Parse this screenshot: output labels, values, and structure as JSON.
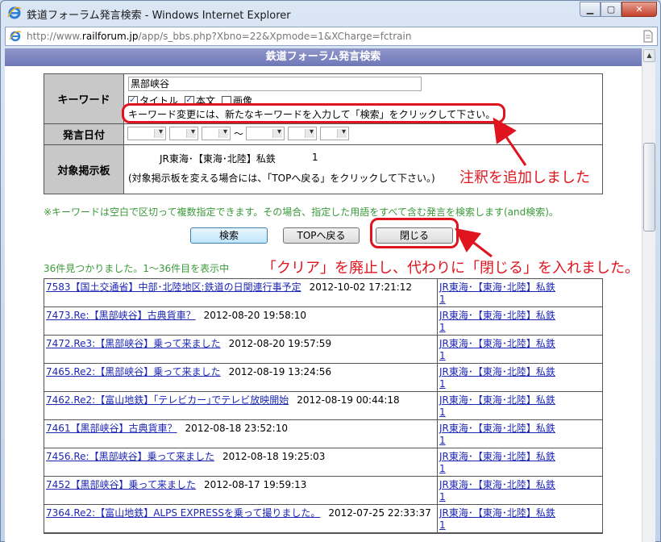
{
  "window": {
    "title": "鉄道フォーラム発言検索 - Windows Internet Explorer",
    "url_prefix": "http://www.",
    "url_host": "railforum.jp",
    "url_rest": "/app/s_bbs.php?Xbno=22&Xpmode=1&XCharge=fctrain"
  },
  "page": {
    "header": "鉄道フォーラム発言検索",
    "keyword": {
      "label": "キーワード",
      "value": "黒部峡谷",
      "opt_title": "タイトル",
      "opt_body": "本文",
      "opt_image": "画像",
      "note": "キーワード変更には、新たなキーワードを入力して「検索」をクリックして下さい。"
    },
    "date": {
      "label": "発言日付",
      "tilde": "〜"
    },
    "board": {
      "label": "対象掲示板",
      "name": "JR東海･【東海･北陸】私鉄",
      "count": "1",
      "note": "(対象掲示板を変える場合には、「TOPへ戻る」をクリックして下さい。)"
    },
    "green_note": "※キーワードは空白で区切って複数指定できます。その場合、指定した用語をすべて含む発言を検索します(and検索)。",
    "buttons": {
      "search": "検索",
      "top": "TOPへ戻る",
      "close": "閉じる"
    },
    "result_count": "36件見つかりました。1〜36件目を表示中",
    "results": [
      {
        "title": "7583【国土交通省】中部･北陸地区:鉄道の日関連行事予定",
        "date": "2012-10-02 17:21:12",
        "board": "JR東海･【東海･北陸】私鉄",
        "board_no": "1"
      },
      {
        "title": "7473.Re:【黒部峡谷】古典貨車？",
        "date": "2012-08-20 19:58:10",
        "board": "JR東海･【東海･北陸】私鉄",
        "board_no": "1"
      },
      {
        "title": "7472.Re3:【黒部峡谷】乗って来ました",
        "date": "2012-08-20 19:57:59",
        "board": "JR東海･【東海･北陸】私鉄",
        "board_no": "1"
      },
      {
        "title": "7465.Re2:【黒部峡谷】乗って来ました",
        "date": "2012-08-19 13:24:56",
        "board": "JR東海･【東海･北陸】私鉄",
        "board_no": "1"
      },
      {
        "title": "7462.Re2:【富山地鉄】｢テレビカー｣でテレビ放映開始",
        "date": "2012-08-19 00:44:18",
        "board": "JR東海･【東海･北陸】私鉄",
        "board_no": "1"
      },
      {
        "title": "7461【黒部峡谷】古典貨車？",
        "date": "2012-08-18 23:52:10",
        "board": "JR東海･【東海･北陸】私鉄",
        "board_no": "1"
      },
      {
        "title": "7456.Re:【黒部峡谷】乗って来ました",
        "date": "2012-08-18 19:25:03",
        "board": "JR東海･【東海･北陸】私鉄",
        "board_no": "1"
      },
      {
        "title": "7452【黒部峡谷】乗って来ました",
        "date": "2012-08-17 19:59:13",
        "board": "JR東海･【東海･北陸】私鉄",
        "board_no": "1"
      },
      {
        "title": "7364.Re2:【富山地鉄】ALPS EXPRESSを乗って撮りました。",
        "date": "2012-07-25 22:33:37",
        "board": "JR東海･【東海･北陸】私鉄",
        "board_no": "1"
      }
    ]
  },
  "annotations": {
    "note_added": "注釈を追加しました",
    "clear_replaced": "「クリア」を廃止し、代わりに「閉じる」を入れました。",
    "color": "#e0141e"
  }
}
